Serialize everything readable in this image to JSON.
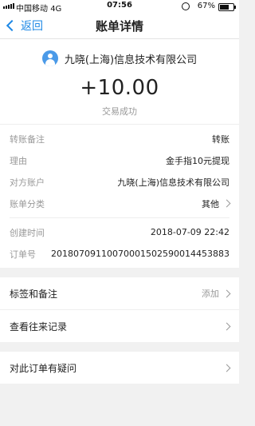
{
  "status_bar": {
    "carrier": "中国移动",
    "network": "4G",
    "time": "07:56",
    "battery": "67%",
    "battery_level": 0.67
  },
  "nav": {
    "back_label": "返回",
    "title": "账单详情"
  },
  "transaction": {
    "payee": "九晓(上海)信息技术有限公司",
    "amount": "+10.00",
    "status": "交易成功"
  },
  "details": [
    {
      "label": "转账备注",
      "value": "转账"
    },
    {
      "label": "理由",
      "value": "金手指10元提现"
    },
    {
      "label": "对方账户",
      "value": "九晓(上海)信息技术有限公司"
    },
    {
      "label": "账单分类",
      "value": "其他"
    }
  ],
  "meta": [
    {
      "label": "创建时间",
      "value": "2018-07-09 22:42"
    },
    {
      "label": "订单号",
      "value": "20180709110070001502590014453883"
    }
  ],
  "actions": {
    "tags_label": "标签和备注",
    "tags_action": "添加",
    "history_label": "查看往来记录",
    "question_label": "对此订单有疑问"
  }
}
